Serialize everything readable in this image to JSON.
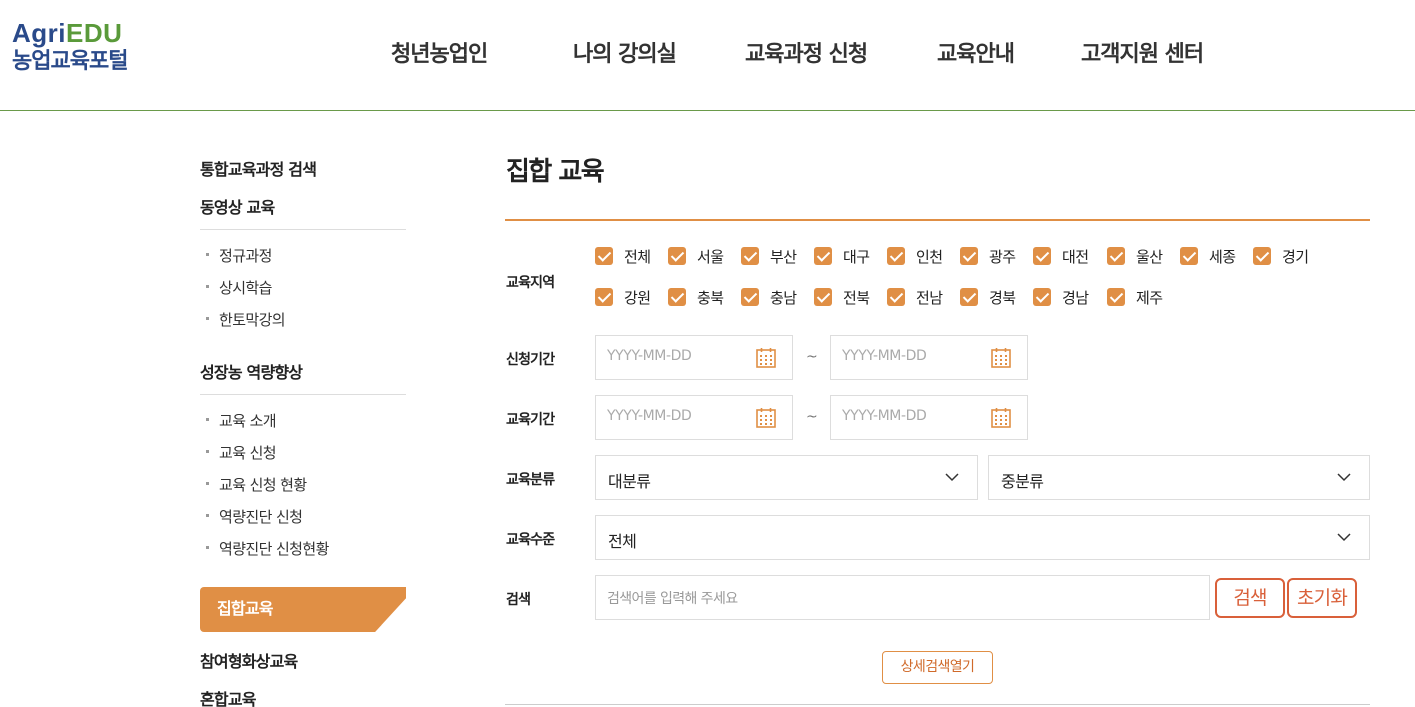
{
  "logo": {
    "agri": "Agri",
    "edu": "EDU",
    "subtitle": "농업교육포털"
  },
  "gnb": [
    "청년농업인",
    "나의 강의실",
    "교육과정 신청",
    "교육안내",
    "고객지원 센터"
  ],
  "sidebar": {
    "sections": [
      {
        "label": "통합교육과정 검색"
      },
      {
        "label": "동영상 교육"
      },
      {
        "label": "성장농 역량향상"
      },
      {
        "label": "참여형화상교육"
      },
      {
        "label": "혼합교육"
      }
    ],
    "video_items": [
      "정규과정",
      "상시학습",
      "한토막강의"
    ],
    "growth_items": [
      "교육 소개",
      "교육 신청",
      "교육 신청 현황",
      "역량진단 신청",
      "역량진단 신청현황"
    ],
    "active": "집합교육"
  },
  "page_title": "집합 교육",
  "form": {
    "region": {
      "label": "교육지역",
      "options": [
        "전체",
        "서울",
        "부산",
        "대구",
        "인천",
        "광주",
        "대전",
        "울산",
        "세종",
        "경기",
        "강원",
        "충북",
        "충남",
        "전북",
        "전남",
        "경북",
        "경남",
        "제주"
      ],
      "checked": true
    },
    "apply_period": {
      "label": "신청기간",
      "start_placeholder": "YYYY-MM-DD",
      "end_placeholder": "YYYY-MM-DD",
      "sep": "~"
    },
    "edu_period": {
      "label": "교육기간",
      "start_placeholder": "YYYY-MM-DD",
      "end_placeholder": "YYYY-MM-DD",
      "sep": "~"
    },
    "category": {
      "label": "교육분류",
      "major": "대분류",
      "middle": "중분류"
    },
    "level": {
      "label": "교육수준",
      "value": "전체"
    },
    "search": {
      "label": "검색",
      "placeholder": "검색어를 입력해 주세요",
      "search_button": "검색",
      "reset_button": "초기화"
    },
    "detail_button": "상세검색열기"
  },
  "colors": {
    "accent": "#e08f45",
    "logo_blue": "#2a4a8a",
    "logo_green": "#5a9a3a",
    "button_red": "#d9603a"
  },
  "icons": {
    "calendar": "calendar-icon",
    "chevron": "chevron-down-icon",
    "check": "check-icon"
  }
}
